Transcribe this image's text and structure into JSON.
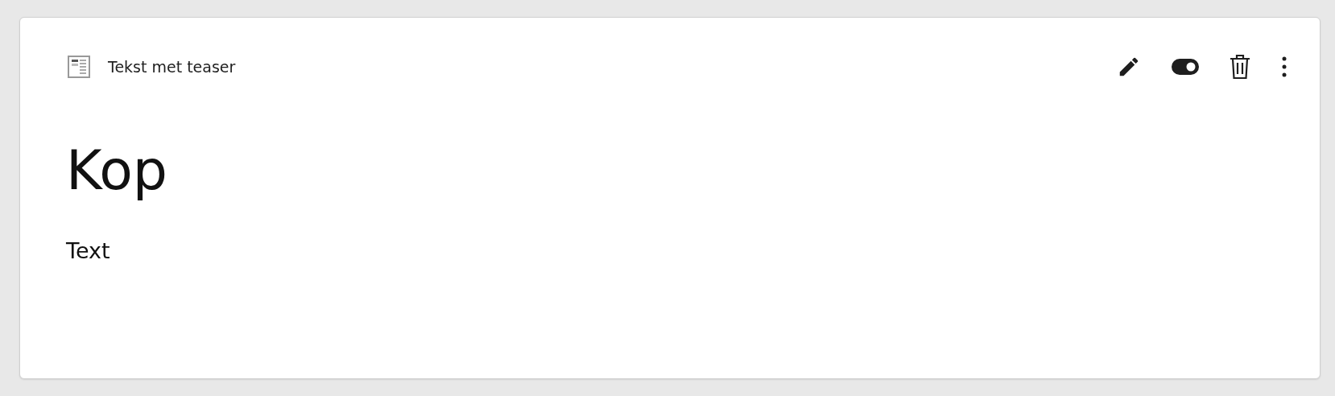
{
  "element": {
    "type_label": "Tekst met teaser",
    "enabled": true
  },
  "content": {
    "heading": "Kop",
    "text": "Text"
  }
}
